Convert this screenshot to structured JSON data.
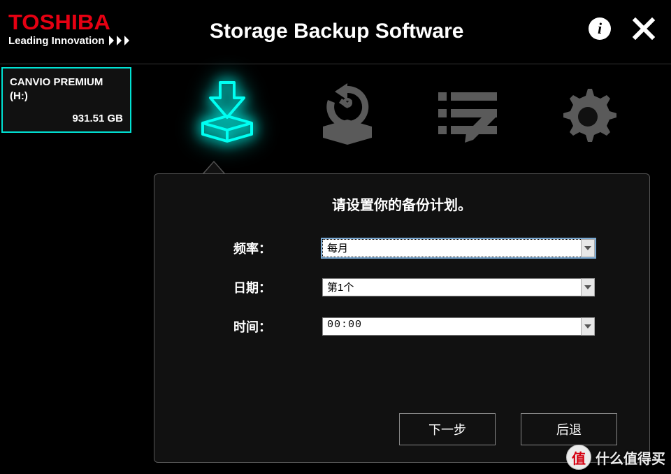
{
  "brand": {
    "name": "TOSHIBA",
    "tagline": "Leading Innovation"
  },
  "app_title": "Storage Backup Software",
  "header_icons": {
    "info": "i",
    "close": "×"
  },
  "sidebar": {
    "drive": {
      "name": "CANVIO PREMIUM (H:)",
      "size": "931.51 GB"
    }
  },
  "toolbar": {
    "backup": "backup-icon",
    "restore": "restore-icon",
    "edit_list": "edit-list-icon",
    "settings": "gear-icon"
  },
  "panel": {
    "title": "请设置你的备份计划。",
    "rows": {
      "frequency": {
        "label": "频率：",
        "value": "每月"
      },
      "date": {
        "label": "日期：",
        "value": "第1个"
      },
      "time": {
        "label": "时间：",
        "value": "00:00"
      }
    },
    "buttons": {
      "next": "下一步",
      "back": "后退"
    }
  },
  "watermark": {
    "badge": "值",
    "text": "什么值得买"
  }
}
